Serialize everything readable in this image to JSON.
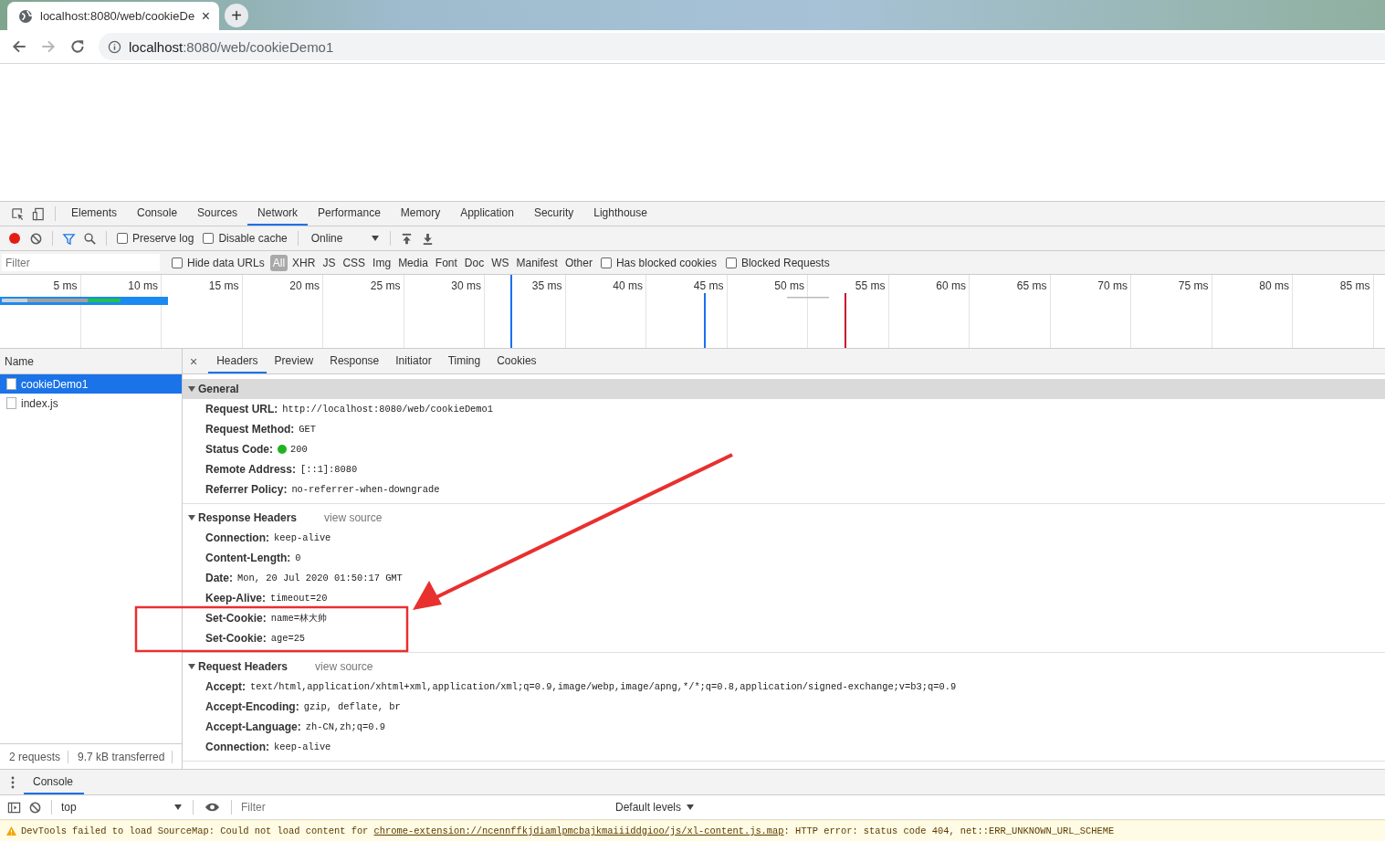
{
  "browser": {
    "tab": {
      "title": "localhost:8080/web/cookieDe",
      "close": "×"
    },
    "new_tab": "+",
    "address": {
      "host": "localhost",
      "path": ":8080/web/cookieDemo1"
    }
  },
  "devtools": {
    "tabs": [
      {
        "label": "Elements",
        "selected": false
      },
      {
        "label": "Console",
        "selected": false
      },
      {
        "label": "Sources",
        "selected": false
      },
      {
        "label": "Network",
        "selected": true
      },
      {
        "label": "Performance",
        "selected": false
      },
      {
        "label": "Memory",
        "selected": false
      },
      {
        "label": "Application",
        "selected": false
      },
      {
        "label": "Security",
        "selected": false
      },
      {
        "label": "Lighthouse",
        "selected": false
      }
    ],
    "toolbar": {
      "recording": true,
      "preserve_log": {
        "label": "Preserve log",
        "checked": false
      },
      "disable_cache": {
        "label": "Disable cache",
        "checked": false
      },
      "throttling": "Online"
    },
    "filter": {
      "placeholder": "Filter",
      "hide_data_urls": {
        "label": "Hide data URLs",
        "checked": false
      },
      "types": [
        {
          "label": "All",
          "selected": true
        },
        {
          "label": "XHR",
          "selected": false
        },
        {
          "label": "JS",
          "selected": false
        },
        {
          "label": "CSS",
          "selected": false
        },
        {
          "label": "Img",
          "selected": false
        },
        {
          "label": "Media",
          "selected": false
        },
        {
          "label": "Font",
          "selected": false
        },
        {
          "label": "Doc",
          "selected": false
        },
        {
          "label": "WS",
          "selected": false
        },
        {
          "label": "Manifest",
          "selected": false
        },
        {
          "label": "Other",
          "selected": false
        }
      ],
      "has_blocked_cookies": {
        "label": "Has blocked cookies",
        "checked": false
      },
      "blocked_requests": {
        "label": "Blocked Requests",
        "checked": false
      }
    },
    "timeline": {
      "ticks": [
        "5 ms",
        "10 ms",
        "15 ms",
        "20 ms",
        "25 ms",
        "30 ms",
        "35 ms",
        "40 ms",
        "45 ms",
        "50 ms",
        "55 ms",
        "60 ms",
        "65 ms",
        "70 ms",
        "75 ms",
        "80 ms",
        "85 ms"
      ]
    },
    "requests": {
      "header": "Name",
      "rows": [
        {
          "name": "cookieDemo1",
          "selected": true
        },
        {
          "name": "index.js",
          "selected": false
        }
      ],
      "summary": [
        "2 requests",
        "9.7 kB transferred"
      ]
    },
    "details": {
      "close": "×",
      "tabs": [
        {
          "label": "Headers",
          "selected": true
        },
        {
          "label": "Preview",
          "selected": false
        },
        {
          "label": "Response",
          "selected": false
        },
        {
          "label": "Initiator",
          "selected": false
        },
        {
          "label": "Timing",
          "selected": false
        },
        {
          "label": "Cookies",
          "selected": false
        }
      ],
      "sections": [
        {
          "title": "General",
          "expanded": true,
          "selected": true,
          "headers": [
            {
              "name": "Request URL:",
              "value": "http://localhost:8080/web/cookieDemo1",
              "kind": "plain"
            },
            {
              "name": "Request Method:",
              "value": "GET",
              "kind": "plain"
            },
            {
              "name": "Status Code:",
              "value": "200",
              "kind": "status"
            },
            {
              "name": "Remote Address:",
              "value": "[::1]:8080",
              "kind": "plain"
            },
            {
              "name": "Referrer Policy:",
              "value": "no-referrer-when-downgrade",
              "kind": "plain"
            }
          ]
        },
        {
          "title": "Response Headers",
          "expanded": true,
          "selected": false,
          "view_source": "view source",
          "headers": [
            {
              "name": "Connection:",
              "value": "keep-alive",
              "kind": "plain"
            },
            {
              "name": "Content-Length:",
              "value": "0",
              "kind": "plain"
            },
            {
              "name": "Date:",
              "value": "Mon, 20 Jul 2020 01:50:17 GMT",
              "kind": "plain"
            },
            {
              "name": "Keep-Alive:",
              "value": "timeout=20",
              "kind": "plain"
            },
            {
              "name": "Set-Cookie:",
              "value": "name=林大帅",
              "kind": "plain"
            },
            {
              "name": "Set-Cookie:",
              "value": "age=25",
              "kind": "plain"
            }
          ]
        },
        {
          "title": "Request Headers",
          "expanded": true,
          "selected": false,
          "view_source": "view source",
          "headers": [
            {
              "name": "Accept:",
              "value": "text/html,application/xhtml+xml,application/xml;q=0.9,image/webp,image/apng,*/*;q=0.8,application/signed-exchange;v=b3;q=0.9",
              "kind": "plain"
            },
            {
              "name": "Accept-Encoding:",
              "value": "gzip, deflate, br",
              "kind": "plain"
            },
            {
              "name": "Accept-Language:",
              "value": "zh-CN,zh;q=0.9",
              "kind": "plain"
            },
            {
              "name": "Connection:",
              "value": "keep-alive",
              "kind": "plain"
            }
          ]
        }
      ]
    }
  },
  "drawer": {
    "tab": "Console",
    "context": "top",
    "filter_placeholder": "Filter",
    "levels": "Default levels",
    "warning": {
      "prefix": "DevTools failed to load SourceMap: Could not load content for ",
      "link": "chrome-extension://ncennffkjdiamlpmcbajkmaiiiddgioo/js/xl-content.js.map",
      "suffix": ": HTTP error: status code 404, net::ERR_UNKNOWN_URL_SCHEME"
    }
  }
}
